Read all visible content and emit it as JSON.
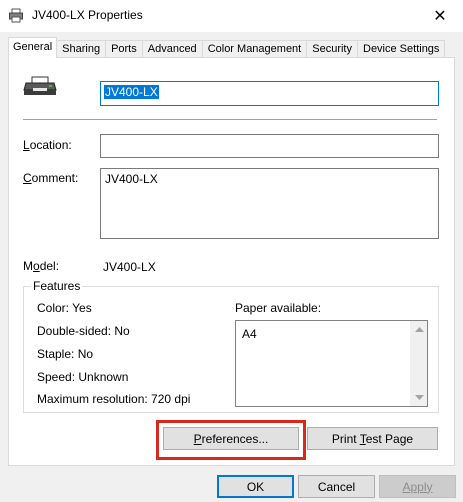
{
  "window": {
    "title": "JV400-LX  Properties",
    "close_glyph": "✕"
  },
  "tabs": [
    {
      "label": "General",
      "active": true
    },
    {
      "label": "Sharing"
    },
    {
      "label": "Ports"
    },
    {
      "label": "Advanced"
    },
    {
      "label": "Color Management"
    },
    {
      "label": "Security"
    },
    {
      "label": "Device Settings"
    }
  ],
  "general": {
    "printer_name": "JV400-LX",
    "location_label_accel": "L",
    "location_label_rest": "ocation:",
    "location_value": "",
    "comment_label_accel": "C",
    "comment_label_rest": "omment:",
    "comment_value": "JV400-LX",
    "model_label_pre": "M",
    "model_label_accel": "o",
    "model_label_rest": "del:",
    "model_value": "JV400-LX"
  },
  "features": {
    "title": "Features",
    "color": "Color: Yes",
    "double_sided": "Double-sided: No",
    "staple": "Staple: No",
    "speed": "Speed: Unknown",
    "max_resolution": "Maximum resolution: 720 dpi",
    "paper_label": "Paper available:",
    "paper_items": [
      "A4"
    ]
  },
  "buttons": {
    "preferences_accel": "P",
    "preferences_rest": "references...",
    "print_test_pre": "Print ",
    "print_test_accel": "T",
    "print_test_rest": "est Page",
    "ok": "OK",
    "cancel": "Cancel",
    "apply": "Apply"
  },
  "colors": {
    "accent": "#0078d7",
    "highlight_border": "#d9291c"
  }
}
